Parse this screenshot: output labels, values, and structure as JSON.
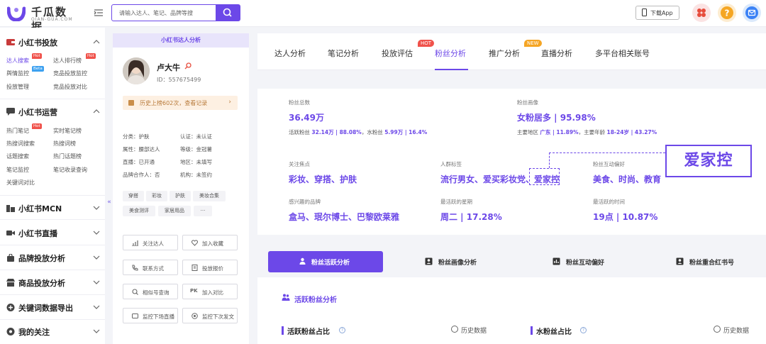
{
  "header": {
    "logo_title": "千瓜数据",
    "logo_sub": "QIAN-GUA.COM",
    "search_placeholder": "请输入达人、笔记、品牌等搜",
    "download_label": "下载App"
  },
  "sidebar": {
    "sections": [
      {
        "label": "小红书投放",
        "links": [
          "达人搜索",
          "达人排行榜",
          "舆情监控",
          "竞品投放监控",
          "投放管理",
          "竞品投放对比"
        ]
      },
      {
        "label": "小红书运营",
        "links": [
          "热门笔记",
          "实时笔记榜",
          "热搜词搜索",
          "热搜词榜",
          "话题搜索",
          "热门话题榜",
          "笔记监控",
          "笔记收录查询",
          "关键词对比"
        ]
      },
      {
        "label": "小红书MCN"
      },
      {
        "label": "小红书直播"
      },
      {
        "label": "品牌投放分析"
      },
      {
        "label": "商品投放分析"
      },
      {
        "label": "关键词数据导出"
      },
      {
        "label": "我的关注"
      }
    ],
    "badges": {
      "hot": "Hot",
      "beta": "Beta"
    },
    "toggle": "«"
  },
  "profile": {
    "banner": "小红书达人分析",
    "name": "卢大牛",
    "id": "ID：557675499",
    "history": "历史上榜602次，查看记录",
    "attrs": {
      "category": "分类：护肤",
      "verified": "认证：未认证",
      "attribute": "属性：腰部达人",
      "level": "等级：金冠薯",
      "live": "直播：已开通",
      "region": "地区：未填写",
      "brand_partner": "品牌合作人：否",
      "agency": "机构：未签约"
    },
    "tags": [
      "穿搭",
      "彩妆",
      "护肤",
      "美妆合集",
      "美食测评",
      "家居用品",
      "···"
    ],
    "actions": [
      "关注达人",
      "加入收藏",
      "联系方式",
      "投放报价",
      "相似号查询",
      "加入对比",
      "监控下场直播",
      "监控下次发文"
    ]
  },
  "main": {
    "tabs": [
      "达人分析",
      "笔记分析",
      "投放评估",
      "粉丝分析",
      "推广分析",
      "直播分析",
      "多平台相关账号"
    ],
    "tab_badges": {
      "hot": "HOT",
      "new": "NEW"
    },
    "stats": {
      "fans_total_label": "粉丝总数",
      "fans_total_value": "36.49万",
      "fans_sub_a": "活跃粉丝 ",
      "fans_sub_a_val": "32.14万 | 88.08%",
      "fans_sub_b": "，水粉丝 ",
      "fans_sub_b_val": "5.99万 | 16.4%",
      "portrait_label": "粉丝画像",
      "portrait_value": "女粉居多 | 95.98%",
      "portrait_sub_a": "主要地区 ",
      "portrait_sub_a_val": "广东 | 11.89%",
      "portrait_sub_b": "，主要年龄 ",
      "portrait_sub_b_val": "18-24岁 | 43.27%",
      "focus_label": "关注焦点",
      "focus_value": "彩妆、穿搭、护肤",
      "crowd_label": "人群标签",
      "crowd_value": "流行男女、爱买彩妆党、爱家控",
      "interact_label": "粉丝互动偏好",
      "interact_value": "美食、时尚、教育",
      "brand_label": "感兴趣的品牌",
      "brand_value": "盒马、珉尔博士、巴黎欧莱雅",
      "week_label": "最活跃的星期",
      "week_value": "周二 | 17.28%",
      "time_label": "最活跃的时间",
      "time_value": "19点 | 10.87%",
      "highlight": "爱家控"
    },
    "sub_tabs": [
      "粉丝活跃分析",
      "粉丝画像分析",
      "粉丝互动偏好",
      "粉丝重合红书号"
    ],
    "active_section": "活跃粉丝分析",
    "active_ratio": "活跃粉丝占比",
    "water_ratio": "水粉丝占比",
    "history_link": "历史数据",
    "help": "?"
  },
  "colors": {
    "accent": "#6c48e8",
    "hot": "#f0524b",
    "new": "#f5a524"
  }
}
